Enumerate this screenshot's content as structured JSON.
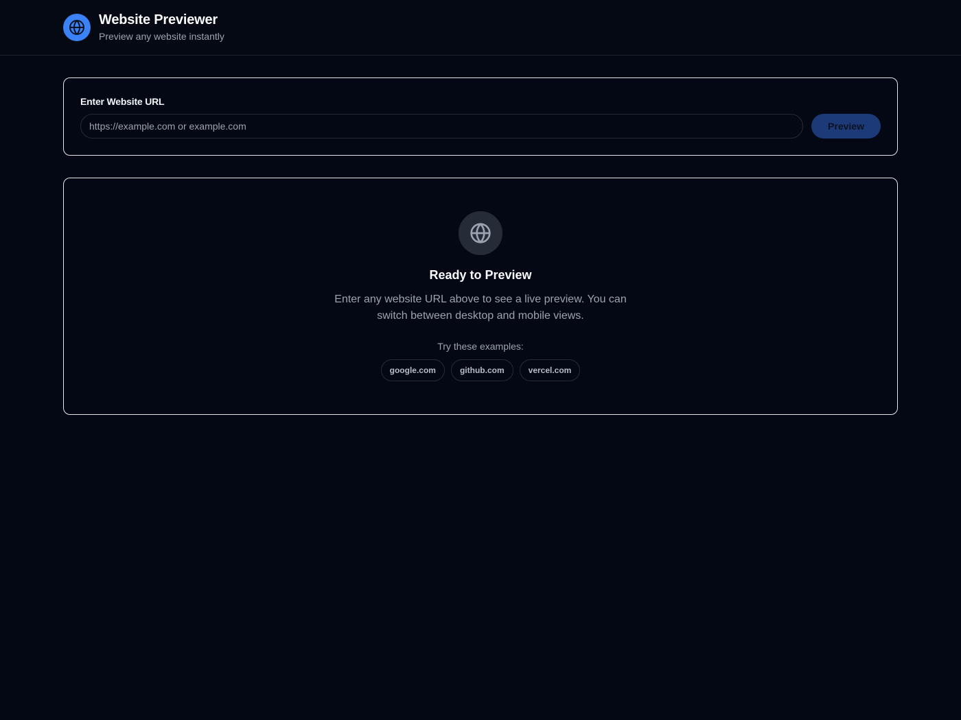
{
  "header": {
    "title": "Website Previewer",
    "subtitle": "Preview any website instantly",
    "logo_icon": "globe-icon",
    "logo_color": "#3b82f6"
  },
  "url_form": {
    "label": "Enter Website URL",
    "input_value": "",
    "placeholder": "https://example.com or example.com",
    "button_label": "Preview",
    "button_color": "#1d3a78"
  },
  "empty_state": {
    "icon": "globe-icon",
    "title": "Ready to Preview",
    "description": "Enter any website URL above to see a live preview. You can switch between desktop and mobile views.",
    "examples_label": "Try these examples:",
    "examples": [
      "google.com",
      "github.com",
      "vercel.com"
    ]
  },
  "colors": {
    "background": "#030814",
    "card_border": "#e6e8eb",
    "muted_text": "#9ca3af"
  }
}
